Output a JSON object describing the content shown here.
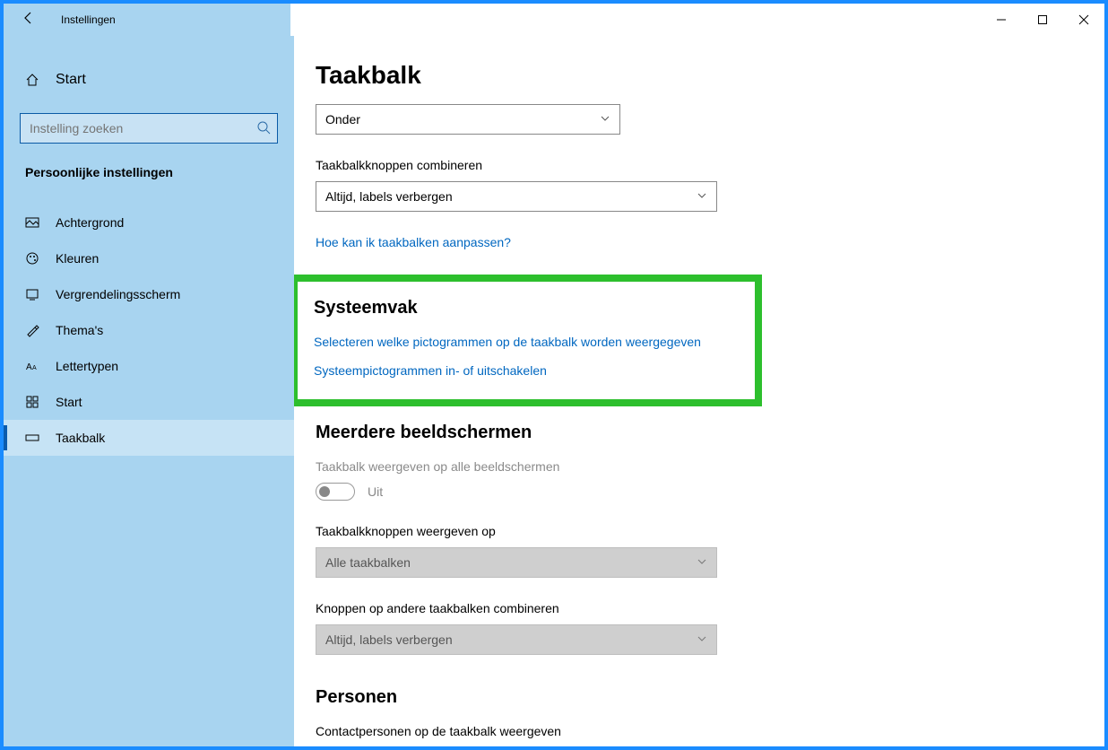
{
  "window": {
    "title": "Instellingen"
  },
  "sidebar": {
    "home": "Start",
    "search_placeholder": "Instelling zoeken",
    "section": "Persoonlijke instellingen",
    "items": [
      {
        "label": "Achtergrond"
      },
      {
        "label": "Kleuren"
      },
      {
        "label": "Vergrendelingsscherm"
      },
      {
        "label": "Thema's"
      },
      {
        "label": "Lettertypen"
      },
      {
        "label": "Start"
      },
      {
        "label": "Taakbalk"
      }
    ]
  },
  "main": {
    "title": "Taakbalk",
    "location_dropdown": "Onder",
    "combine_label": "Taakbalkknoppen combineren",
    "combine_dropdown": "Altijd, labels verbergen",
    "help_link": "Hoe kan ik taakbalken aanpassen?",
    "systray_heading": "Systeemvak",
    "systray_link1": "Selecteren welke pictogrammen op de taakbalk worden weergegeven",
    "systray_link2": "Systeempictogrammen in- of uitschakelen",
    "multi_heading": "Meerdere beeldschermen",
    "multi_toggle_label": "Taakbalk weergeven op alle beeldschermen",
    "multi_toggle_state": "Uit",
    "multi_show_on_label": "Taakbalkknoppen weergeven op",
    "multi_show_on_value": "Alle taakbalken",
    "multi_combine_label": "Knoppen op andere taakbalken combineren",
    "multi_combine_value": "Altijd, labels verbergen",
    "people_heading": "Personen",
    "people_label": "Contactpersonen op de taakbalk weergeven"
  }
}
